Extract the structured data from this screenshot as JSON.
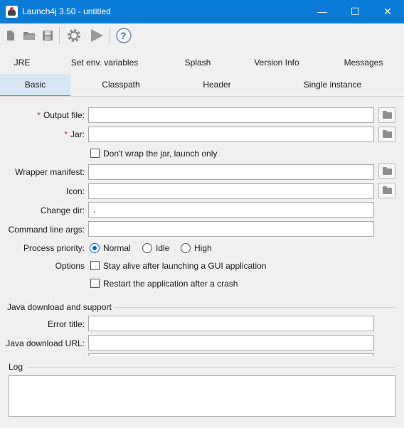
{
  "window": {
    "title": "Launch4j 3.50 - untitled",
    "controls": {
      "minimize": "—",
      "maximize": "☐",
      "close": "✕"
    }
  },
  "toolbar": {
    "icons": [
      "new-file-icon",
      "open-folder-icon",
      "save-icon",
      "build-gear-icon",
      "run-play-icon",
      "help-icon"
    ],
    "help_glyph": "?"
  },
  "tabs": {
    "row1": [
      "JRE",
      "Set env. variables",
      "Splash",
      "Version Info",
      "Messages"
    ],
    "row2": [
      "Basic",
      "Classpath",
      "Header",
      "Single instance"
    ],
    "selected": "Basic"
  },
  "form": {
    "required_mark": "*",
    "output_file": {
      "label": "Output file:",
      "value": ""
    },
    "jar": {
      "label": "Jar:",
      "value": ""
    },
    "dont_wrap": {
      "label": "Don't wrap the jar, launch only",
      "checked": false
    },
    "wrapper_manifest": {
      "label": "Wrapper manifest:",
      "value": ""
    },
    "icon": {
      "label": "Icon:",
      "value": ""
    },
    "change_dir": {
      "label": "Change dir:",
      "value": "."
    },
    "cmd_args": {
      "label": "Command line args:",
      "value": ""
    },
    "priority": {
      "label": "Process priority:",
      "options": [
        "Normal",
        "Idle",
        "High"
      ],
      "selected": "Normal"
    },
    "options": {
      "label": "Options",
      "stay_alive": {
        "label": "Stay alive after launching a GUI application",
        "checked": false
      },
      "restart": {
        "label": "Restart the application after a crash",
        "checked": false
      }
    }
  },
  "java_download": {
    "title": "Java download and support",
    "error_title": {
      "label": "Error title:",
      "value": ""
    },
    "download_url": {
      "label": "Java download URL:",
      "value": ""
    }
  },
  "log": {
    "title": "Log",
    "content": ""
  },
  "colors": {
    "titlebar": "#0b7bd8",
    "selected_tab": "#d7e6f3",
    "required": "#c62828",
    "radio_checked": "#0a64c2"
  }
}
